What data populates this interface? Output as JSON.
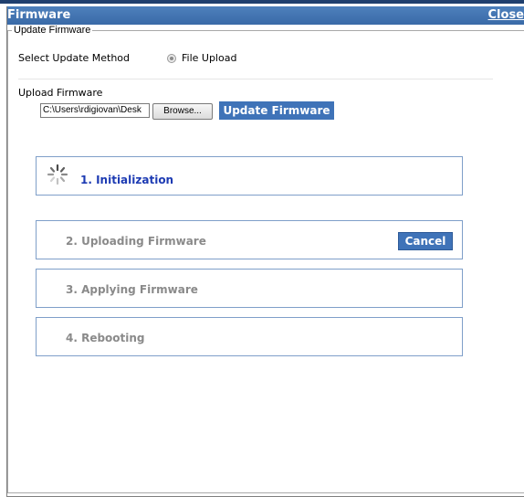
{
  "dialog": {
    "title": "Firmware",
    "close_label": "Close"
  },
  "update_firmware": {
    "legend": "Update Firmware",
    "method_label": "Select Update Method",
    "method_option": "File Upload",
    "upload_label": "Upload Firmware",
    "file_path": "C:\\Users\\rdigiovan\\Desk",
    "browse_label": "Browse...",
    "update_button": "Update Firmware"
  },
  "steps": [
    {
      "label": "1. Initialization",
      "state": "active"
    },
    {
      "label": "2. Uploading Firmware",
      "state": "pending",
      "cancel_label": "Cancel"
    },
    {
      "label": "3. Applying Firmware",
      "state": "pending"
    },
    {
      "label": "4. Rebooting",
      "state": "pending"
    }
  ],
  "colors": {
    "titlebar": "#4274b4",
    "step_border": "#7f9fc9",
    "active_step_text": "#1d3bb3",
    "inactive_step_text": "#8a8a8a",
    "button": "#3f73b8"
  },
  "icons": {
    "loading": "spinner-icon",
    "radio": "radio-selected-icon"
  }
}
